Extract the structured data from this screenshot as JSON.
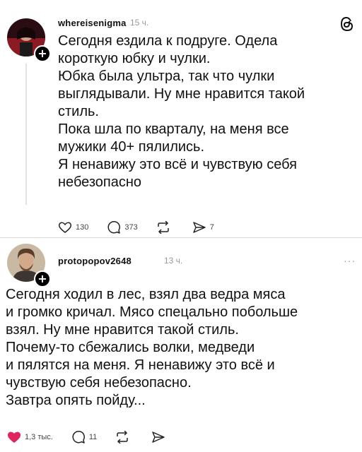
{
  "posts": [
    {
      "username": "whereisenigma",
      "time": "15 ч.",
      "lines": [
        "Сегодня ездила к подруге. Одела",
        "короткую юбку и чулки.",
        "Юбка была ультра, так что чулки",
        "выглядывали. Ну мне нравится такой",
        "стиль.",
        "Пока шла по кварталу, на меня все",
        "мужики 40+ пялились.",
        "Я ненавижу это всё и чувствую себя",
        "небезопасно"
      ],
      "likes": "130",
      "comments": "373",
      "reposts": "",
      "shares": "7"
    },
    {
      "username": "protopopov2648",
      "time": "13 ч.",
      "lines": [
        "Сегодня ходил в лес, взял два ведра мяса",
        "и громко кричал. Мясо спецально побольше",
        "взял. Ну мне нравится такой стиль.",
        "Почему-то сбежались волки, медведи",
        "и пялятся на меня. Я ненавижу это всё и",
        "чувствую себя небезопасно.",
        "Завтра опять пойду..."
      ],
      "likes": "1,3 тыс.",
      "comments": "11",
      "reposts": "",
      "shares": ""
    }
  ],
  "icons": {
    "threads_logo": "threads-logo-icon",
    "more": "more-icon",
    "follow": "plus-icon",
    "like": "heart-icon",
    "comment": "comment-icon",
    "repost": "repost-icon",
    "share": "share-icon"
  },
  "colors": {
    "liked": "#e0245e",
    "muted": "#9a9a9a"
  }
}
